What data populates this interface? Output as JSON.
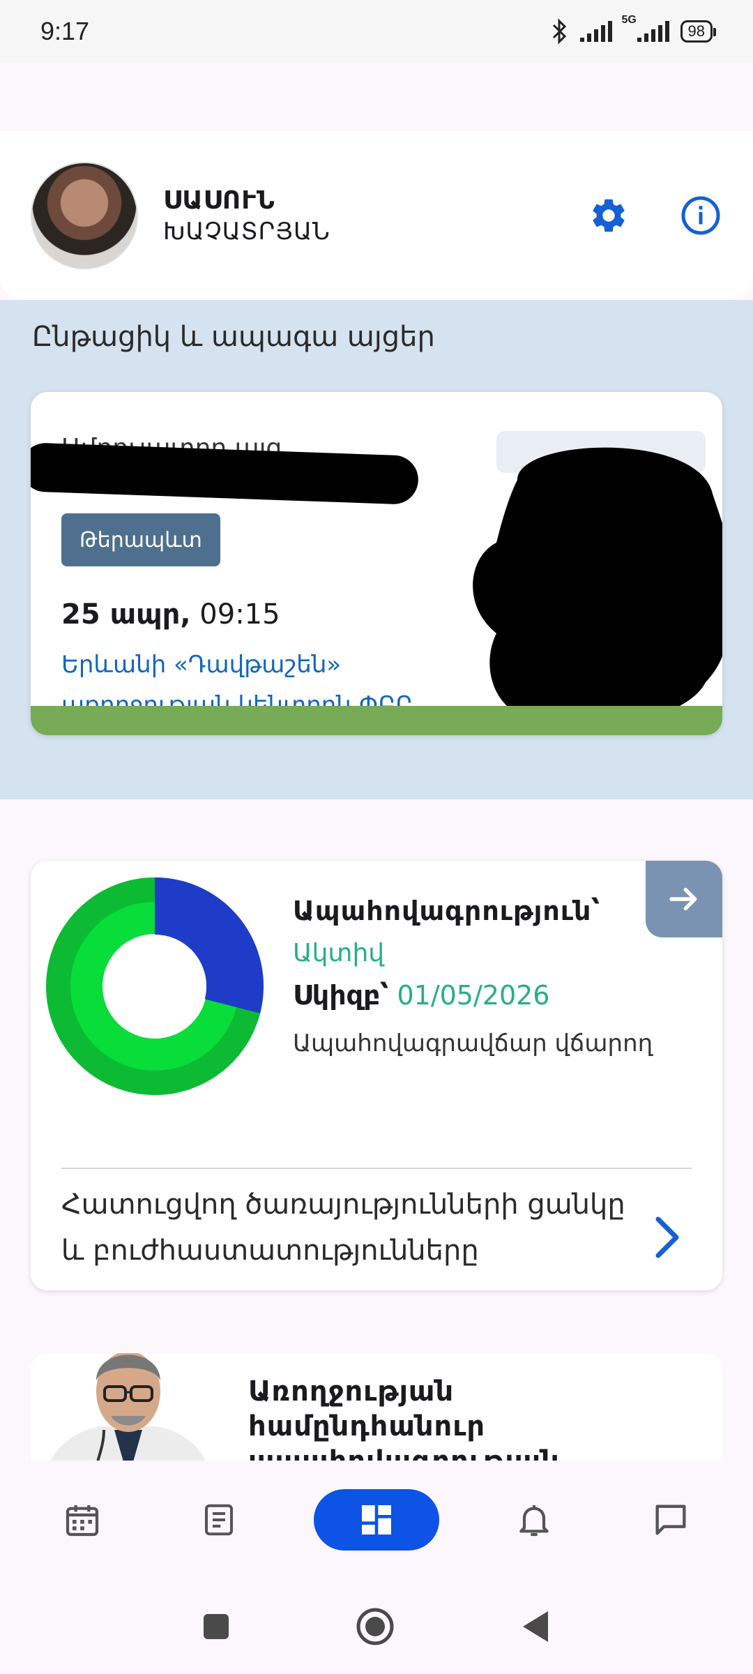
{
  "status_bar": {
    "time": "9:17",
    "network_label": "5G",
    "battery": "98",
    "icons": [
      "bluetooth-icon",
      "signal-icon",
      "signal-5g-icon",
      "battery-icon"
    ]
  },
  "profile": {
    "first_name": "ՍԱՍՈՒՆ",
    "last_name": "ԽԱՉԱՏՐՅԱՆ",
    "actions": [
      "settings-icon",
      "info-icon"
    ]
  },
  "visits": {
    "section_title": "Ընթացիկ և ապագա այցեր",
    "card": {
      "doctor_name": "Ամբուլատոր այց",
      "specialty": "Թերապևտ",
      "date": "25 ապր,",
      "time": " 09:15",
      "place": "Երևանի «Դավթաշեն» առողջության կենտրոն ՓԲԸ",
      "status_color": "#77ab58"
    }
  },
  "insurance": {
    "title": "Ապահովագրություն՝",
    "status": "Ակտիվ",
    "start_label": "Սկիզբ՝",
    "start_date": "01/05/2026",
    "payer": "Ապահովագրավճար վճարող",
    "services_link": "Հատուցվող ծառայությունների ցանկը և բուժհաստատությունները",
    "chart_colors": {
      "primary": "#1f3cc8",
      "secondary": "#08dd3a",
      "outer": "#0cbb33"
    },
    "chart_fraction_used": 0.29
  },
  "promo": {
    "title": "Առողջության համընդհանուր ապահովագրության"
  },
  "bottom_nav": {
    "items": [
      "calendar-icon",
      "document-icon",
      "dashboard-icon",
      "bell-icon",
      "chat-icon"
    ],
    "active": "dashboard-icon",
    "accent": "#0d54e6"
  },
  "system_nav": [
    "recents-button",
    "home-button",
    "back-button"
  ]
}
